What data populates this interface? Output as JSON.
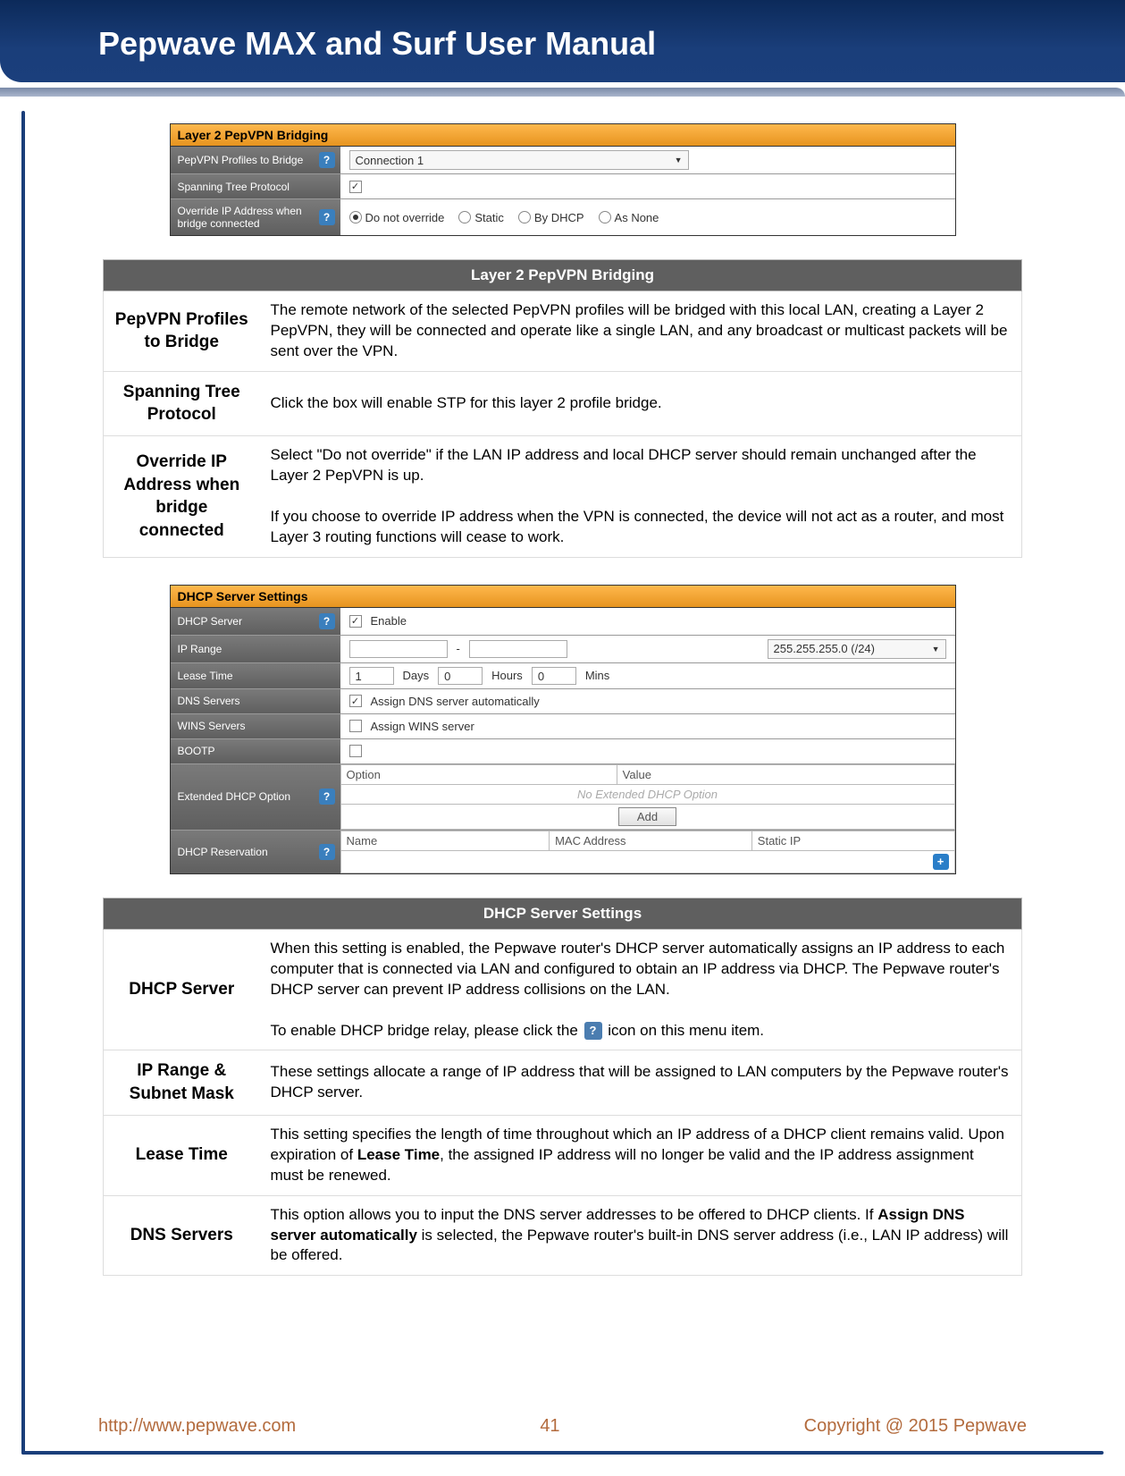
{
  "doc_title": "Pepwave MAX and Surf User Manual",
  "footer": {
    "url": "http://www.pepwave.com",
    "page": "41",
    "copyright": "Copyright @ 2015 Pepwave"
  },
  "ui1": {
    "header": "Layer 2 PepVPN Bridging",
    "rows": {
      "profiles_label": "PepVPN Profiles to Bridge",
      "profiles_value": "Connection 1",
      "stp_label": "Spanning Tree Protocol",
      "override_label": "Override IP Address when bridge connected",
      "override_options": [
        "Do not override",
        "Static",
        "By DHCP",
        "As None"
      ]
    }
  },
  "table1": {
    "header": "Layer 2 PepVPN Bridging",
    "rows": [
      {
        "label": "PepVPN Profiles to Bridge",
        "desc": "The remote network of the selected PepVPN profiles will be bridged with this local LAN, creating a Layer 2 PepVPN, they will be connected and operate like a single LAN, and any broadcast or multicast packets will be sent over the VPN."
      },
      {
        "label": "Spanning Tree Protocol",
        "desc": "Click the box will enable STP for this layer 2 profile bridge."
      },
      {
        "label": "Override IP Address when bridge connected",
        "desc_p1": "Select \"Do not override\" if the LAN IP address and local DHCP server should remain unchanged after the Layer 2 PepVPN is up.",
        "desc_p2": "If you choose to override IP address when the VPN is connected, the device will not act as a router, and most Layer 3 routing functions will cease to work."
      }
    ]
  },
  "ui2": {
    "header": "DHCP Server Settings",
    "rows": {
      "dhcp_server_label": "DHCP Server",
      "dhcp_server_enable": "Enable",
      "ip_range_label": "IP Range",
      "ip_range_sep": "-",
      "ip_range_mask": "255.255.255.0 (/24)",
      "lease_label": "Lease Time",
      "lease_days_val": "1",
      "lease_days": "Days",
      "lease_hours_val": "0",
      "lease_hours": "Hours",
      "lease_mins_val": "0",
      "lease_mins": "Mins",
      "dns_label": "DNS Servers",
      "dns_auto": "Assign DNS server automatically",
      "wins_label": "WINS Servers",
      "wins_assign": "Assign WINS server",
      "bootp_label": "BOOTP",
      "ext_label": "Extended DHCP Option",
      "ext_h_option": "Option",
      "ext_h_value": "Value",
      "ext_empty": "No Extended DHCP Option",
      "ext_add": "Add",
      "resv_label": "DHCP Reservation",
      "resv_h_name": "Name",
      "resv_h_mac": "MAC Address",
      "resv_h_ip": "Static IP"
    }
  },
  "table2": {
    "header": "DHCP Server Settings",
    "rows": [
      {
        "label": "DHCP Server",
        "desc_p1": "When this setting is enabled, the Pepwave router's DHCP server automatically assigns an IP address to each computer that is connected via LAN and configured to obtain an IP address via DHCP. The Pepwave router's DHCP server can prevent IP address collisions on the LAN.",
        "desc_p2a": "To enable DHCP bridge relay, please click the ",
        "desc_p2b": " icon on this menu item."
      },
      {
        "label": "IP Range & Subnet Mask",
        "desc": "These settings allocate a range of IP address that will be assigned to LAN computers by the Pepwave router's DHCP server."
      },
      {
        "label": "Lease Time",
        "desc_pre": "This setting specifies the length of time throughout which an IP address of a DHCP client remains valid. Upon expiration of ",
        "desc_bold": "Lease Time",
        "desc_post": ", the assigned IP address will no longer be valid and the IP address assignment must be renewed."
      },
      {
        "label": "DNS Servers",
        "desc_pre": "This option allows you to input the DNS server addresses to be offered to DHCP clients. If ",
        "desc_bold": "Assign DNS server automatically",
        "desc_post": " is selected, the Pepwave router's built-in DNS server address (i.e., LAN IP address) will be offered."
      }
    ]
  }
}
